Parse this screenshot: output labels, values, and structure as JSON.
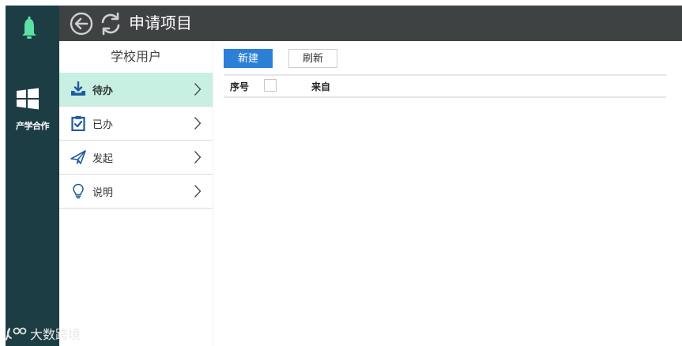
{
  "rail": {
    "app_label": "产学合作"
  },
  "titlebar": {
    "title": "申请项目"
  },
  "sidebar": {
    "header": "学校用户",
    "items": [
      {
        "label": "待办",
        "icon": "download-tray-icon",
        "active": true
      },
      {
        "label": "已办",
        "icon": "clipboard-check-icon",
        "active": false
      },
      {
        "label": "发起",
        "icon": "paper-plane-icon",
        "active": false
      },
      {
        "label": "说明",
        "icon": "lightbulb-icon",
        "active": false
      }
    ]
  },
  "toolbar": {
    "new_label": "新建",
    "refresh_label": "刷新"
  },
  "table": {
    "columns": [
      "序号",
      "来自"
    ],
    "rows": []
  },
  "watermark": {
    "text": "大数跨境"
  },
  "colors": {
    "rail_bg": "#1d3d45",
    "titlebar_bg": "#3f4243",
    "active_item_bg": "#c8f0e2",
    "primary_button": "#2b7fd6",
    "bell_icon": "#5ce0a6",
    "accent_icon": "#1e5aa0"
  }
}
